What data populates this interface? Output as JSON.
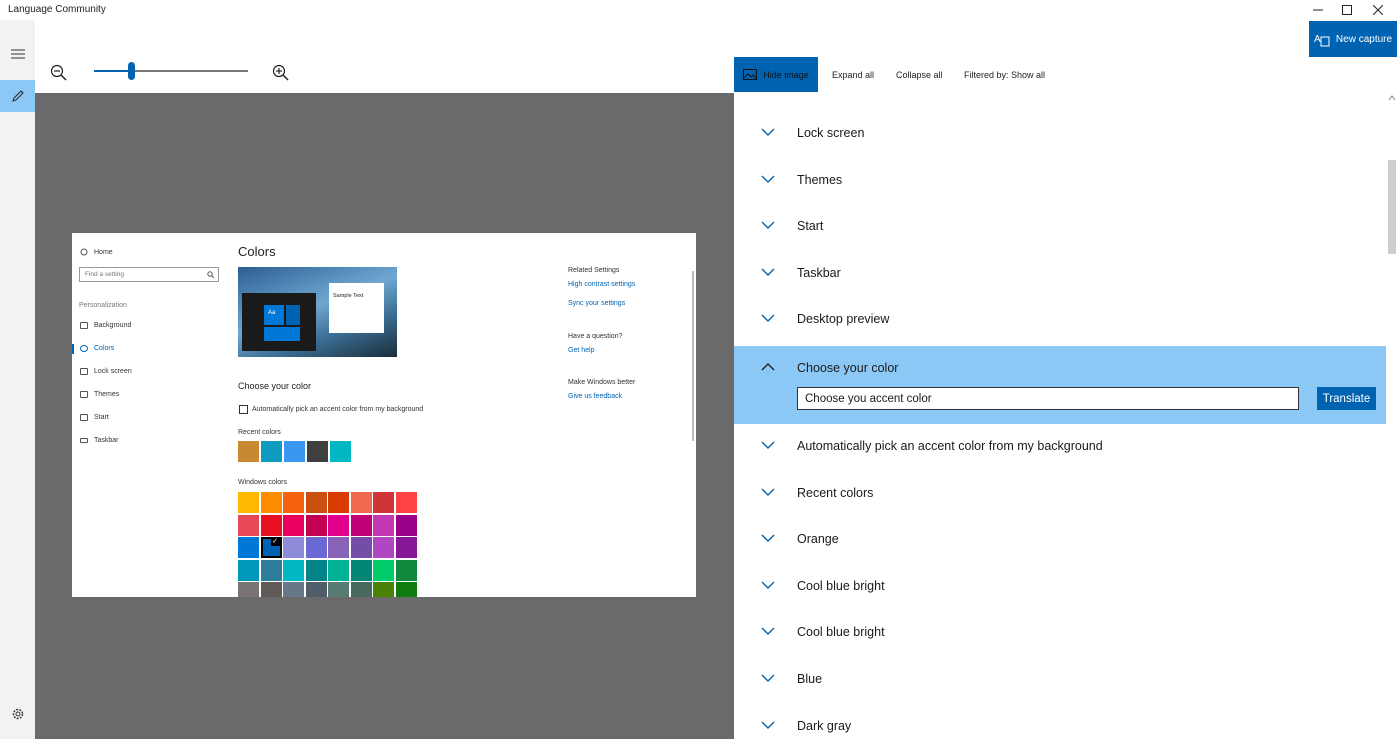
{
  "window": {
    "title": "Language Community"
  },
  "rail": {
    "icons": [
      "hamburger-icon",
      "pencil-icon",
      "gear-icon"
    ]
  },
  "zoom": {
    "level": 0.24
  },
  "toolbar": {
    "new_capture": "New capture",
    "hide_image": "Hide image",
    "expand_all": "Expand all",
    "collapse_all": "Collapse all",
    "filter": "Filtered by: Show all"
  },
  "preview": {
    "nav_home": "Home",
    "search_placeholder": "Find a setting",
    "section": "Personalization",
    "nav_items": [
      "Background",
      "Colors",
      "Lock screen",
      "Themes",
      "Start",
      "Taskbar"
    ],
    "page_title": "Colors",
    "sample_text": "Sample Text",
    "tile_text": "Aa",
    "choose_color": "Choose your color",
    "auto_pick": "Automatically pick an accent color from my background",
    "recent_colors": "Recent colors",
    "windows_colors": "Windows colors",
    "related_title": "Related Settings",
    "high_contrast": "High contrast settings",
    "sync": "Sync your settings",
    "question": "Have a question?",
    "get_help": "Get help",
    "make_better": "Make Windows better",
    "feedback": "Give us feedback",
    "recent_swatches": [
      "#c98930",
      "#0d9bc0",
      "#3a96f0",
      "#404040",
      "#00b7c3"
    ],
    "palette": [
      [
        "#ffb900",
        "#ff8c00",
        "#f7630c",
        "#ca5010",
        "#da3b01",
        "#ef6950",
        "#d13438",
        "#ff4343"
      ],
      [
        "#e74856",
        "#e81123",
        "#ea005e",
        "#c30052",
        "#e3008c",
        "#bf0077",
        "#c239b3",
        "#9a0089"
      ],
      [
        "#0078d7",
        "#0063b1",
        "#8e8cd8",
        "#6b69d6",
        "#8764b8",
        "#744da9",
        "#b146c2",
        "#881798"
      ],
      [
        "#0099bc",
        "#2d7d9a",
        "#00b7c3",
        "#038387",
        "#00b294",
        "#018574",
        "#00cc6a",
        "#10893e"
      ],
      [
        "#7a7574",
        "#5d5a58",
        "#68768a",
        "#515c6b",
        "#567c73",
        "#486860",
        "#498205",
        "#107c10"
      ]
    ]
  },
  "list": {
    "items": [
      "Lock screen",
      "Themes",
      "Start",
      "Taskbar",
      "Desktop preview",
      "Choose your color",
      "Automatically pick an accent color from my background",
      "Recent colors",
      "Orange",
      "Cool blue bright",
      "Cool blue bright",
      "Blue",
      "Dark gray"
    ],
    "expanded_value": "Choose you accent color",
    "translate": "Translate"
  },
  "colors": {
    "accent": "#0063b1",
    "selected_row": "#8cc8f5",
    "preview_bg": "#6a6a6a"
  }
}
